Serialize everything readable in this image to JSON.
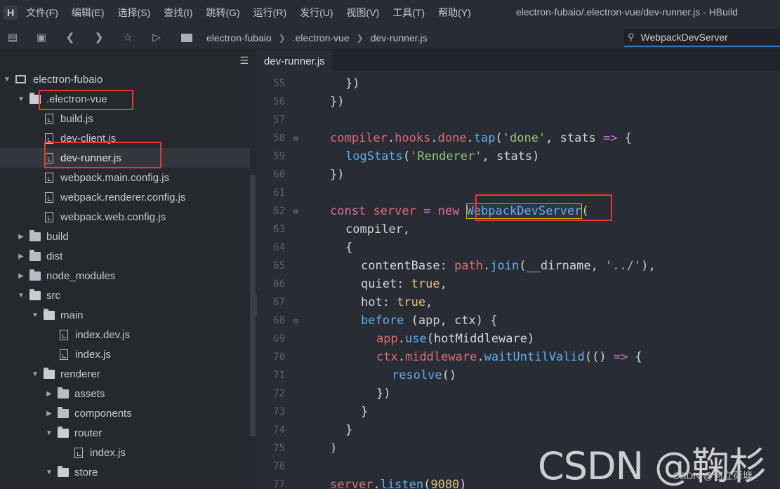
{
  "menubar": {
    "logo_text": "H",
    "items": [
      "文件(F)",
      "编辑(E)",
      "选择(S)",
      "查找(I)",
      "跳转(G)",
      "运行(R)",
      "发行(U)",
      "视图(V)",
      "工具(T)",
      "帮助(Y)"
    ],
    "window_title": "electron-fubaio/.electron-vue/dev-runner.js - HBuild"
  },
  "toolbar": {
    "breadcrumb": [
      "electron-fubaio",
      ".electron-vue",
      "dev-runner.js"
    ],
    "search_value": "WebpackDevServer"
  },
  "sidebar": {
    "project": "electron-fubaio",
    "items": [
      {
        "label": ".electron-vue",
        "type": "folder",
        "open": true
      },
      {
        "label": "build.js",
        "type": "file"
      },
      {
        "label": "dev-client.js",
        "type": "file"
      },
      {
        "label": "dev-runner.js",
        "type": "file",
        "active": true
      },
      {
        "label": "webpack.main.config.js",
        "type": "file"
      },
      {
        "label": "webpack.renderer.config.js",
        "type": "file"
      },
      {
        "label": "webpack.web.config.js",
        "type": "file"
      },
      {
        "label": "build",
        "type": "folder"
      },
      {
        "label": "dist",
        "type": "folder"
      },
      {
        "label": "node_modules",
        "type": "folder"
      },
      {
        "label": "src",
        "type": "folder",
        "open": true
      },
      {
        "label": "main",
        "type": "folder",
        "open": true
      },
      {
        "label": "index.dev.js",
        "type": "file"
      },
      {
        "label": "index.js",
        "type": "file"
      },
      {
        "label": "renderer",
        "type": "folder",
        "open": true
      },
      {
        "label": "assets",
        "type": "folder"
      },
      {
        "label": "components",
        "type": "folder"
      },
      {
        "label": "router",
        "type": "folder",
        "open": true
      },
      {
        "label": "index.js",
        "type": "file"
      },
      {
        "label": "store",
        "type": "folder",
        "open": true
      }
    ]
  },
  "editor": {
    "tab_label": "dev-runner.js",
    "line_numbers": [
      "55",
      "56",
      "57",
      "58",
      "59",
      "60",
      "61",
      "62",
      "63",
      "64",
      "65",
      "66",
      "67",
      "68",
      "69",
      "70",
      "71",
      "72",
      "73",
      "74",
      "75",
      "76",
      "77"
    ]
  },
  "watermark": {
    "large": "CSDN @鞠杉",
    "small": "CSDN @何立荷塘"
  },
  "colors": {
    "highlight_box": "#e53935",
    "background": "#282c34",
    "keyword": "#e06c9f",
    "function": "#61afef",
    "string": "#98c379"
  }
}
